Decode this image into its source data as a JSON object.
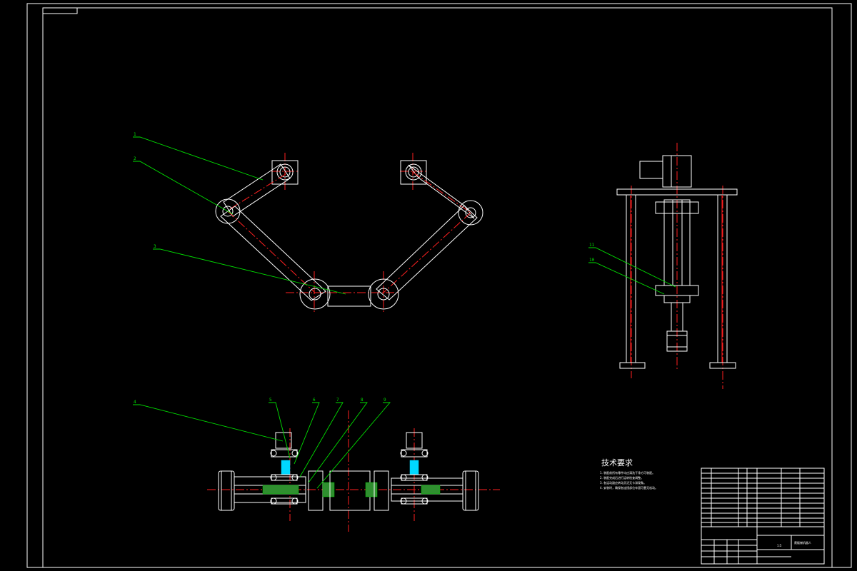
{
  "drawing": {
    "tech_title": "技术要求",
    "notes": [
      "1. 装配前所有零件均应清洗干净方可装配。",
      "2. 装配完成后进行运转检查调整。",
      "3. 各运动副应转动灵活无卡滞现象。",
      "4. 安装时，确保各连接部位牢固可靠无松动。"
    ],
    "title_block": {
      "name": "爬楼梯机器人",
      "scale": "1:5"
    }
  },
  "callouts": [
    "1",
    "2",
    "3",
    "4",
    "5",
    "6",
    "7",
    "8",
    "9",
    "10",
    "11"
  ]
}
